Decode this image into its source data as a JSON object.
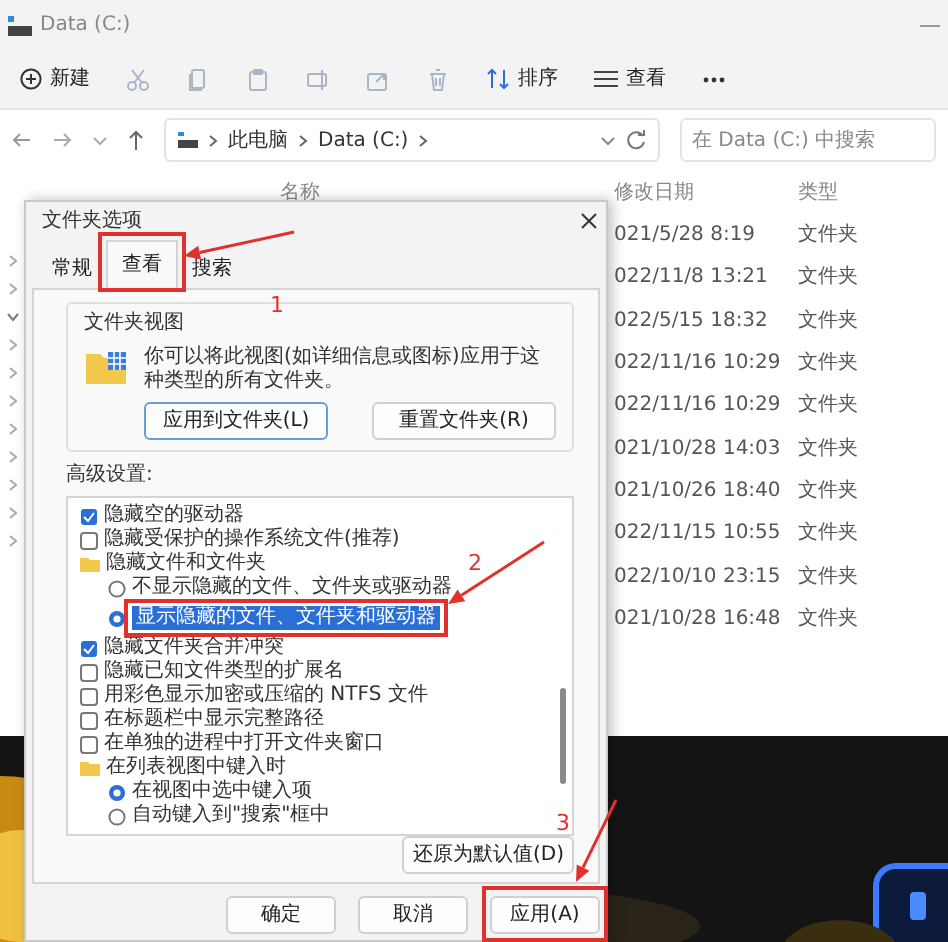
{
  "window": {
    "title": "Data (C:)"
  },
  "toolbar": {
    "new_label": "新建",
    "tools": [
      {
        "kind": "cut",
        "disabled": true
      },
      {
        "kind": "copy",
        "disabled": true
      },
      {
        "kind": "paste",
        "disabled": true
      },
      {
        "kind": "rename",
        "disabled": true
      },
      {
        "kind": "share",
        "disabled": true
      },
      {
        "kind": "delete",
        "disabled": true
      }
    ],
    "sort_label": "排序",
    "view_label": "查看"
  },
  "address": {
    "crumbs": [
      "此电脑",
      "Data (C:)"
    ],
    "search": {
      "placeholder": "在 Data (C:) 中搜索"
    }
  },
  "nav": [
    {
      "expanded": false
    },
    {
      "expanded": false
    },
    {
      "expanded": true
    },
    {
      "expanded": false
    },
    {
      "expanded": false
    },
    {
      "expanded": false
    },
    {
      "expanded": false
    },
    {
      "expanded": false
    },
    {
      "expanded": false
    },
    {
      "expanded": false
    },
    {
      "expanded": false
    }
  ],
  "file_list": {
    "columns": [
      "名称",
      "修改日期",
      "类型"
    ],
    "rows": [
      {
        "modified": "021/5/28 8:19",
        "type": "文件夹"
      },
      {
        "modified": "022/11/8 13:21",
        "type": "文件夹"
      },
      {
        "modified": "022/5/15 18:32",
        "type": "文件夹"
      },
      {
        "modified": "022/11/16 10:29",
        "type": "文件夹"
      },
      {
        "modified": "022/11/16 10:29",
        "type": "文件夹"
      },
      {
        "modified": "021/10/28 14:03",
        "type": "文件夹"
      },
      {
        "modified": "021/10/26 18:40",
        "type": "文件夹"
      },
      {
        "modified": "022/11/15 10:55",
        "type": "文件夹"
      },
      {
        "modified": "022/10/10 23:15",
        "type": "文件夹"
      },
      {
        "modified": "021/10/28 16:48",
        "type": "文件夹"
      }
    ]
  },
  "dialog": {
    "title": "文件夹选项",
    "tabs": [
      {
        "label": "常规",
        "selected": false
      },
      {
        "label": "查看",
        "selected": true
      },
      {
        "label": "搜索",
        "selected": false
      }
    ],
    "folder_view": {
      "title": "文件夹视图",
      "description": "你可以将此视图(如详细信息或图标)应用于这种类型的所有文件夹。",
      "buttons": [
        "应用到文件夹(L)",
        "重置文件夹(R)"
      ]
    },
    "advanced_label": "高级设置:",
    "settings": [
      {
        "kind": "checkbox",
        "label": "隐藏空的驱动器",
        "checked": true,
        "selected": false
      },
      {
        "kind": "checkbox",
        "label": "隐藏受保护的操作系统文件(推荐)",
        "checked": false,
        "selected": false
      },
      {
        "kind": "folder",
        "label": "隐藏文件和文件夹",
        "children": [
          {
            "kind": "radio",
            "label": "不显示隐藏的文件、文件夹或驱动器",
            "checked": false,
            "selected": false
          },
          {
            "kind": "radio",
            "label": "显示隐藏的文件、文件夹和驱动器",
            "checked": true,
            "selected": true
          }
        ]
      },
      {
        "kind": "checkbox",
        "label": "隐藏文件夹合并冲突",
        "checked": true,
        "selected": false
      },
      {
        "kind": "checkbox",
        "label": "隐藏已知文件类型的扩展名",
        "checked": false,
        "selected": false
      },
      {
        "kind": "checkbox",
        "label": "用彩色显示加密或压缩的 NTFS 文件",
        "checked": false,
        "selected": false
      },
      {
        "kind": "checkbox",
        "label": "在标题栏中显示完整路径",
        "checked": false,
        "selected": false
      },
      {
        "kind": "checkbox",
        "label": "在单独的进程中打开文件夹窗口",
        "checked": false,
        "selected": false
      },
      {
        "kind": "folder",
        "label": "在列表视图中键入时",
        "children": [
          {
            "kind": "radio",
            "label": "在视图中选中键入项",
            "checked": true,
            "selected": false
          },
          {
            "kind": "radio",
            "label": "自动键入到\"搜索\"框中",
            "checked": false,
            "selected": false
          }
        ]
      }
    ],
    "restore_button": "还原为默认值(D)",
    "buttons": [
      "确定",
      "取消",
      "应用(A)"
    ]
  },
  "annotations": [
    {
      "label": "1"
    },
    {
      "label": "2"
    },
    {
      "label": "3"
    }
  ]
}
